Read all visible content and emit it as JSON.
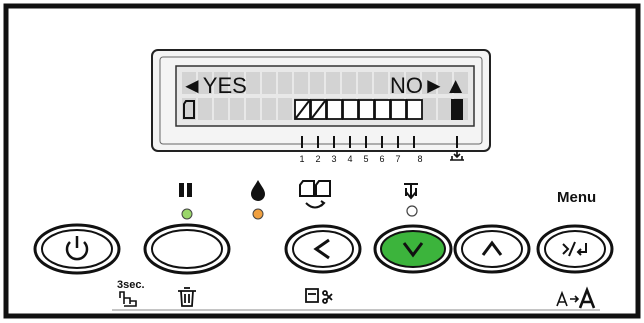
{
  "lcd": {
    "left_option": "◄YES",
    "right_option": "NO►▲",
    "slot_numbers": [
      "1",
      "2",
      "3",
      "4",
      "5",
      "6",
      "7",
      "8"
    ]
  },
  "labels": {
    "menu": "Menu",
    "hold_time": "3sec."
  },
  "buttons": [
    {
      "name": "power-button",
      "icon": "power-icon"
    },
    {
      "name": "pause-reset-button",
      "icon": "pause-icon"
    },
    {
      "name": "paper-source-left-button",
      "icon": "chevron-left-icon"
    },
    {
      "name": "down-button",
      "icon": "chevron-down-icon"
    },
    {
      "name": "up-button",
      "icon": "chevron-up-icon"
    },
    {
      "name": "menu-enter-button",
      "icon": "enter-icon"
    }
  ],
  "colors": {
    "frame": "#111111",
    "lcd_bg": "#e8e8e8",
    "lcd_cell": "#d3d3d3",
    "down_button_fill": "#3cb43c",
    "pause_led": "#9ad66a",
    "ink_led": "#f0a040"
  }
}
